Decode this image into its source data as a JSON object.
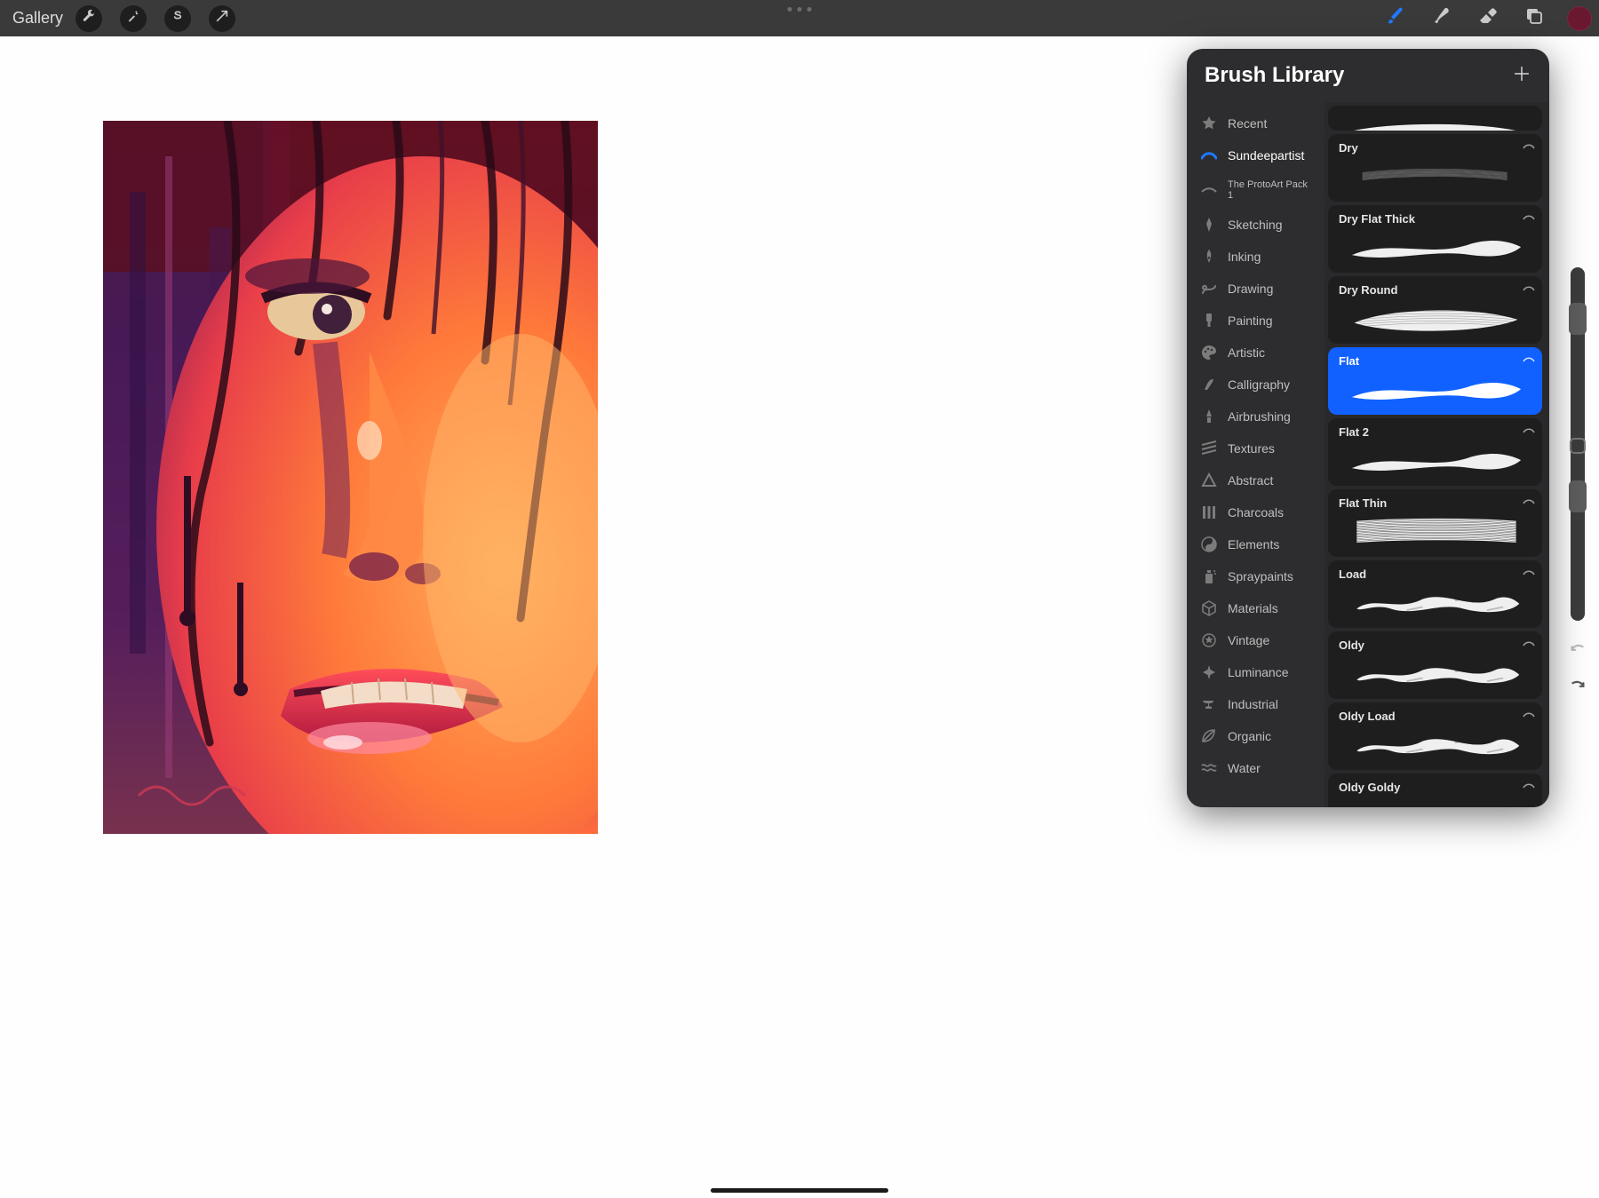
{
  "topbar": {
    "gallery_label": "Gallery",
    "color_swatch": "#6a1830"
  },
  "brush_library": {
    "title": "Brush Library",
    "categories": [
      {
        "id": "recent",
        "label": "Recent",
        "icon": "star",
        "active": false
      },
      {
        "id": "sundeepartist",
        "label": "Sundeepartist",
        "icon": "stroke",
        "active": true
      },
      {
        "id": "protoart",
        "label": "The ProtoArt Pack 1",
        "icon": "stroke2",
        "active": false,
        "small": true
      },
      {
        "id": "sketching",
        "label": "Sketching",
        "icon": "pencil",
        "active": false
      },
      {
        "id": "inking",
        "label": "Inking",
        "icon": "pen-nib",
        "active": false
      },
      {
        "id": "drawing",
        "label": "Drawing",
        "icon": "scribble",
        "active": false
      },
      {
        "id": "painting",
        "label": "Painting",
        "icon": "wide-brush",
        "active": false
      },
      {
        "id": "artistic",
        "label": "Artistic",
        "icon": "palette",
        "active": false
      },
      {
        "id": "calligraphy",
        "label": "Calligraphy",
        "icon": "calligraphy",
        "active": false
      },
      {
        "id": "airbrushing",
        "label": "Airbrushing",
        "icon": "airbrush",
        "active": false
      },
      {
        "id": "textures",
        "label": "Textures",
        "icon": "hatch",
        "active": false
      },
      {
        "id": "abstract",
        "label": "Abstract",
        "icon": "triangle",
        "active": false
      },
      {
        "id": "charcoals",
        "label": "Charcoals",
        "icon": "bars",
        "active": false
      },
      {
        "id": "elements",
        "label": "Elements",
        "icon": "yinyang",
        "active": false
      },
      {
        "id": "spraypaints",
        "label": "Spraypaints",
        "icon": "spraycan",
        "active": false
      },
      {
        "id": "materials",
        "label": "Materials",
        "icon": "cube",
        "active": false
      },
      {
        "id": "vintage",
        "label": "Vintage",
        "icon": "badge",
        "active": false
      },
      {
        "id": "luminance",
        "label": "Luminance",
        "icon": "sparkle",
        "active": false
      },
      {
        "id": "industrial",
        "label": "Industrial",
        "icon": "anvil",
        "active": false
      },
      {
        "id": "organic",
        "label": "Organic",
        "icon": "leaf",
        "active": false
      },
      {
        "id": "water",
        "label": "Water",
        "icon": "waves",
        "active": false
      }
    ],
    "brushes": [
      {
        "name": "",
        "stroke": "peek",
        "selected": false,
        "peek": true
      },
      {
        "name": "Dry",
        "stroke": "thin",
        "selected": false
      },
      {
        "name": "Dry Flat Thick",
        "stroke": "flat",
        "selected": false
      },
      {
        "name": "Dry Round",
        "stroke": "round",
        "selected": false
      },
      {
        "name": "Flat",
        "stroke": "flat",
        "selected": true
      },
      {
        "name": "Flat 2",
        "stroke": "flat",
        "selected": false
      },
      {
        "name": "Flat Thin",
        "stroke": "lines",
        "selected": false
      },
      {
        "name": "Load",
        "stroke": "rough",
        "selected": false
      },
      {
        "name": "Oldy",
        "stroke": "rough",
        "selected": false
      },
      {
        "name": "Oldy Load",
        "stroke": "rough",
        "selected": false
      },
      {
        "name": "Oldy Goldy",
        "stroke": "rough",
        "selected": false
      }
    ]
  }
}
